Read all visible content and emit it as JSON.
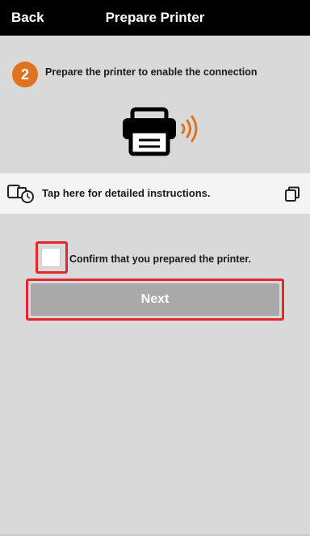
{
  "header": {
    "back_label": "Back",
    "title": "Prepare Printer",
    "background": "#000000"
  },
  "step": {
    "number": "2",
    "text": "Prepare the printer to enable the connection",
    "badge_color": "#e0731f"
  },
  "illustration": {
    "icon": "printer-wireless-icon"
  },
  "instructions": {
    "label": "Tap here for detailed instructions.",
    "leading_icon": "device-clock-icon",
    "trailing_icon": "copy-icon"
  },
  "confirm": {
    "label": "Confirm that you prepared the printer.",
    "checked": false,
    "highlight_color": "#e5262d"
  },
  "next": {
    "label": "Next",
    "enabled": false,
    "color": "#a9a9a9"
  }
}
